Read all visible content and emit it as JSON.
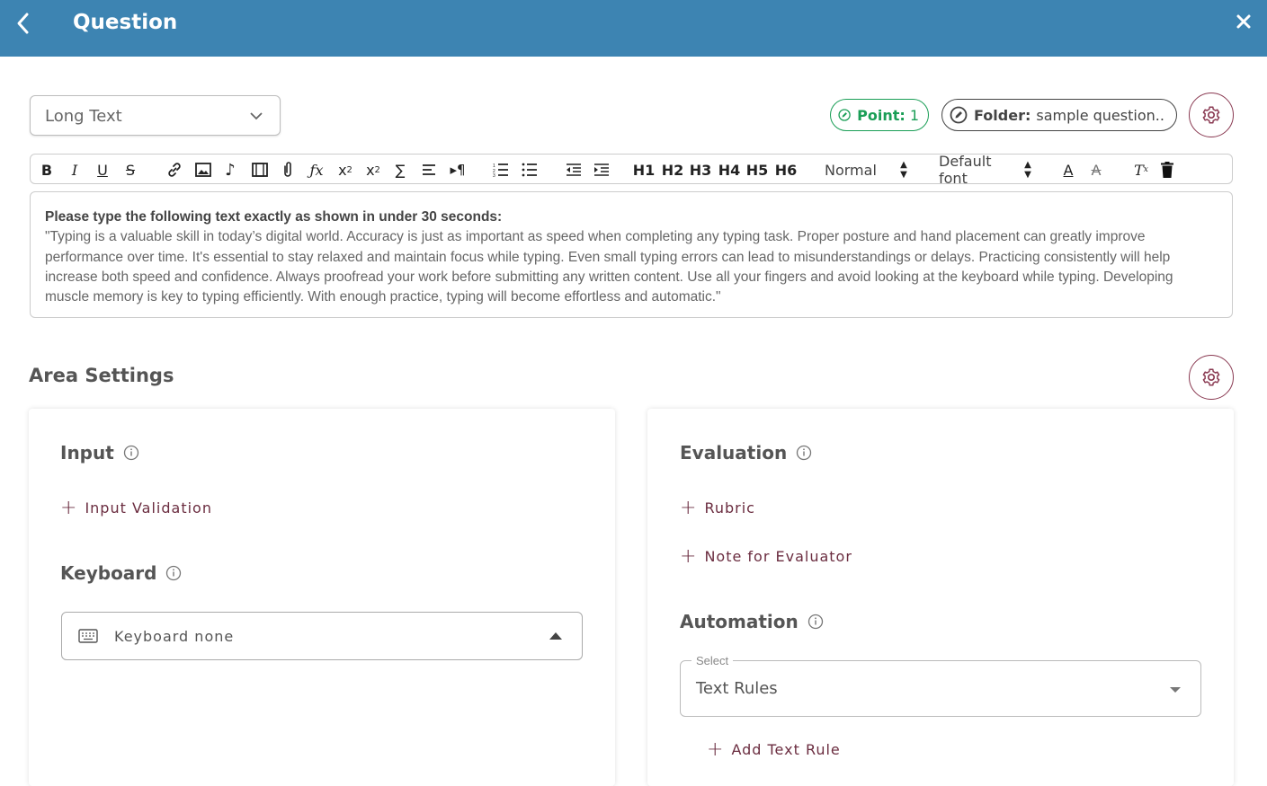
{
  "header": {
    "title": "Question"
  },
  "question_type": {
    "value": "Long Text"
  },
  "point": {
    "label": "Point:",
    "value": "1"
  },
  "folder": {
    "label": "Folder:",
    "value": "sample question.."
  },
  "toolbar": {
    "headings": [
      "H1",
      "H2",
      "H3",
      "H4",
      "H5",
      "H6"
    ],
    "size_value": "Normal",
    "font_value": "Default font"
  },
  "editor": {
    "lead": "Please type the following text exactly as shown in under 30 seconds:",
    "body": "\"Typing is a valuable skill in today’s digital world. Accuracy is just as important as speed when completing any typing task. Proper posture and hand placement can greatly improve performance over time. It's essential to stay relaxed and maintain focus while typing. Even small typing errors can lead to misunderstandings or delays. Practicing consistently will help increase both speed and confidence. Always proofread your work before submitting any written content. Use all your fingers and avoid looking at the keyboard while typing. Developing muscle memory is key to typing efficiently. With enough practice, typing will become effortless and automatic.\""
  },
  "area_settings": {
    "title": "Area Settings"
  },
  "input_section": {
    "title": "Input",
    "add_validation": "Input Validation",
    "keyboard_title": "Keyboard",
    "keyboard_value": "Keyboard none"
  },
  "evaluation_section": {
    "title": "Evaluation",
    "add_rubric": "Rubric",
    "add_note": "Note for Evaluator",
    "automation_title": "Automation",
    "select_legend": "Select",
    "select_value": "Text Rules",
    "add_text_rule": "Add Text Rule"
  },
  "colors": {
    "header_bg": "#3d84b2",
    "point_green": "#1a9e56",
    "accent_maroon": "#6b2d40"
  }
}
